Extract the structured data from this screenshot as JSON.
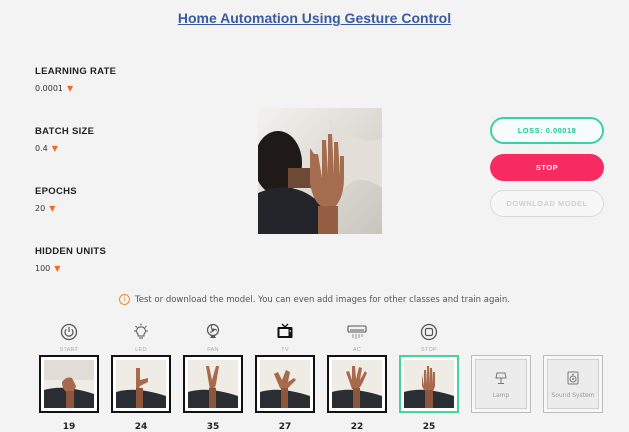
{
  "title": "Home Automation Using Gesture Control",
  "params": [
    {
      "label": "LEARNING RATE",
      "value": "0.0001"
    },
    {
      "label": "BATCH SIZE",
      "value": "0.4"
    },
    {
      "label": "EPOCHS",
      "value": "20"
    },
    {
      "label": "HIDDEN UNITS",
      "value": "100"
    }
  ],
  "buttons": {
    "loss": "LOSS: 0.00018",
    "stop": "STOP",
    "download": "DOWNLOAD MODEL"
  },
  "info_text": "Test or download the model. You can even add images for other classes and train again.",
  "classes": [
    {
      "label": "START",
      "icon": "power-icon",
      "count": "19"
    },
    {
      "label": "LED",
      "icon": "bulb-icon",
      "count": "24"
    },
    {
      "label": "FAN",
      "icon": "fan-icon",
      "count": "35"
    },
    {
      "label": "TV",
      "icon": "tv-icon",
      "count": "27"
    },
    {
      "label": "AC",
      "icon": "ac-icon",
      "count": "22"
    },
    {
      "label": "STOP",
      "icon": "stop-icon",
      "count": "25"
    }
  ],
  "extra_classes": [
    {
      "label": "Lamp",
      "icon": "lamp-icon"
    },
    {
      "label": "Sound System",
      "icon": "speaker-icon"
    }
  ],
  "colors": {
    "accent": "#f72a62",
    "loss": "#37d3a5",
    "title": "#3a5a9f",
    "caret": "#f06b2b"
  }
}
